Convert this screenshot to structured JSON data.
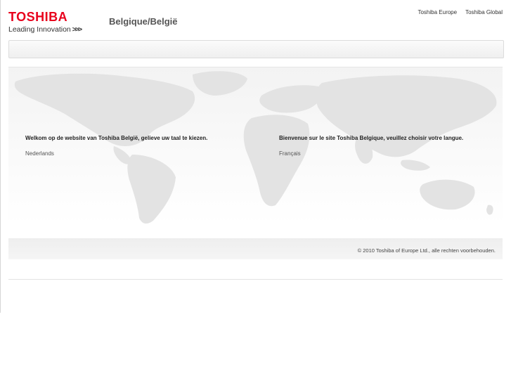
{
  "header": {
    "logo_word": "TOSHIBA",
    "tagline": "Leading Innovation",
    "tagline_mark": ">>>",
    "region_title": "Belgique/België",
    "links": [
      "Toshiba Europe",
      "Toshiba Global"
    ],
    "brand_color": "#e8001c"
  },
  "welcome": {
    "nl": {
      "text": "Welkom op de website van Toshiba België, gelieve uw taal te kiezen.",
      "link": "Nederlands"
    },
    "fr": {
      "text": "Bienvenue sur le site Toshiba Belgique, veuillez choisir votre langue.",
      "link": "Français"
    }
  },
  "footer": {
    "copyright": "© 2010 Toshiba of Europe Ltd., alle rechten voorbehouden."
  },
  "icons": [
    "world-map-graphic",
    "chevrons-icon"
  ]
}
